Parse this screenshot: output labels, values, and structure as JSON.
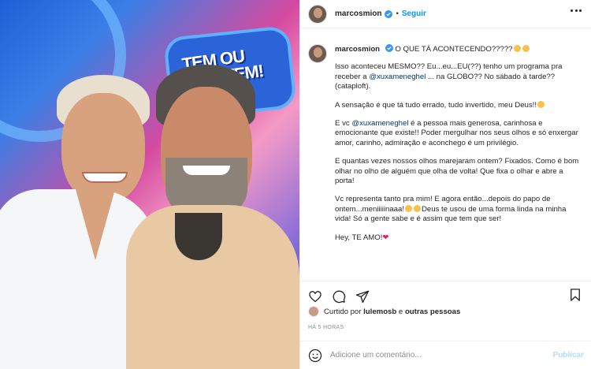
{
  "media": {
    "logo_text": "TEM OU NÃO TEM!",
    "accent_colors": [
      "#2b63d9",
      "#d54aa0",
      "#f59ac6"
    ]
  },
  "header": {
    "username": "marcosmion",
    "separator": "•",
    "follow_label": "Seguir"
  },
  "caption": {
    "username": "marcosmion",
    "first_line": "O QUE TÁ ACONTECENDO?????",
    "p1_a": "Isso aconteceu MESMO?? Eu...eu...EU(??) tenho um programa pra receber a ",
    "p1_mention": "@xuxamenеghel",
    "p1_b": " ... na GLOBO?? No sábado à tarde?? (cataploft).",
    "p2": "A sensação é que tá tudo errado, tudo invertido, meu Deus!!",
    "p3_a": "E vc ",
    "p3_mention": "@xuxameneghel",
    "p3_b": " é a pessoa mais generosa, carinhosa e emocionante que existe!! Poder mergulhar nos seus olhos e só enxergar amor, carinho, admiração e aconchego é um privilégio.",
    "p4": "E quantas vezes nossos olhos marejaram ontem? Fixados. Como é bom olhar no olho de alguém que olha de volta! Que fixa o olhar e abre a porta!",
    "p5_a": "Vc representa tanto pra mim! E agora então...depois do papo de ontem...meniiiiinaaa!",
    "p5_b": "Deus te usou de uma forma linda na minha vida! Só a gente sabe e é assim que tem que ser!",
    "p6": "Hey, TE AMO!"
  },
  "likes": {
    "prefix": "Curtido por ",
    "user": "lulemosb",
    "suffix": " e ",
    "others": "outras pessoas"
  },
  "timestamp": "HÁ 5 HORAS",
  "comment_input": {
    "placeholder": "Adicione um comentário...",
    "publish_label": "Publicar"
  }
}
